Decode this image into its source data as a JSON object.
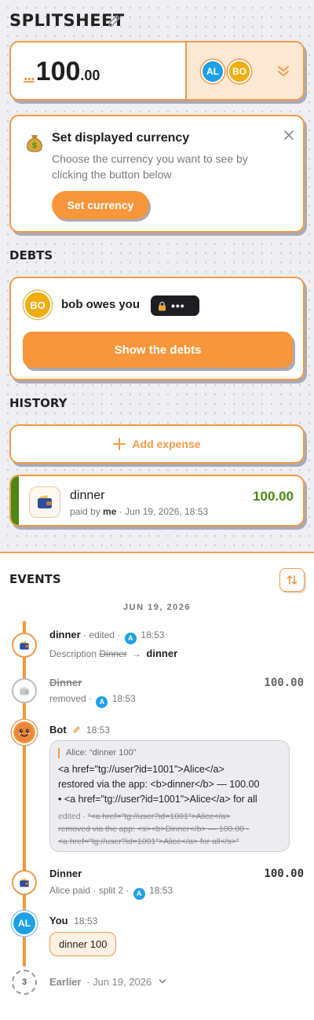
{
  "header": {
    "app_title": "SPLITSHEET"
  },
  "balance": {
    "currency_placeholder": "...",
    "amount_main": "100",
    "amount_cents": ".00",
    "avatars": [
      "AL",
      "BO"
    ]
  },
  "currency_notice": {
    "icon": "money-bag",
    "title": "Set displayed currency",
    "body_line1": "Choose the currency you want to see by",
    "body_line2": "clicking the button below",
    "button_label": "Set currency"
  },
  "debts": {
    "section_label": "DEBTS",
    "avatar": "BO",
    "text": "bob owes you",
    "hidden_amount": "•••",
    "button_label": "Show the debts"
  },
  "history": {
    "section_label": "HISTORY",
    "add_label": "Add expense",
    "expense": {
      "title": "dinner",
      "paid_by_prefix": "paid by ",
      "paid_by_name": "me",
      "date": " · Jun 19, 2026, 18:53",
      "amount": "100.00"
    }
  },
  "events": {
    "section_label": "EVENTS",
    "date_divider": "JUN 19, 2026",
    "items": [
      {
        "title": "dinner",
        "meta": " · edited · ",
        "avatar": "A",
        "time": "18:53",
        "detail_prefix": "Description ",
        "old_value": "Dinner",
        "arrow": "→",
        "new_value": "dinner"
      },
      {
        "title": "Dinner",
        "amount": "100.00",
        "meta": "removed · ",
        "avatar": "A",
        "time": "18:53"
      },
      {
        "title": "Bot",
        "time": "18:53",
        "quote": "Alice: “dinner 100”",
        "message_lines": [
          "<a href=\"tg://user?id=1001\">Alice</a>",
          "restored via the app: <b>dinner</b> — 100.00",
          "• <a href=\"tg://user?id=1001\">Alice</a> for all"
        ],
        "edited_prefix": "edited · ",
        "edited_lines": [
          "“<a href=\"tg://user?id=1001\">Alice</a>",
          "removed via the app: <s><b>Dinner</b> — 100.00 ·",
          "<a href=\"tg://user?id=1001\">Alice</a> for all</s>”"
        ]
      },
      {
        "title": "Dinner",
        "amount": "100.00",
        "meta": "Alice paid · split 2 · ",
        "avatar": "A",
        "time": "18:53"
      },
      {
        "title": "You",
        "avatar": "AL",
        "time": "18:53",
        "bubble": "dinner 100"
      }
    ],
    "earlier": {
      "count": "3",
      "label": "Earlier",
      "date": " · Jun 19, 2026"
    }
  },
  "colors": {
    "accent": "#f7963a",
    "border": "#f29b49",
    "positive": "#4b8a12",
    "avatar_blue": "#1ea0e6",
    "avatar_yellow": "#f0ad0f"
  }
}
